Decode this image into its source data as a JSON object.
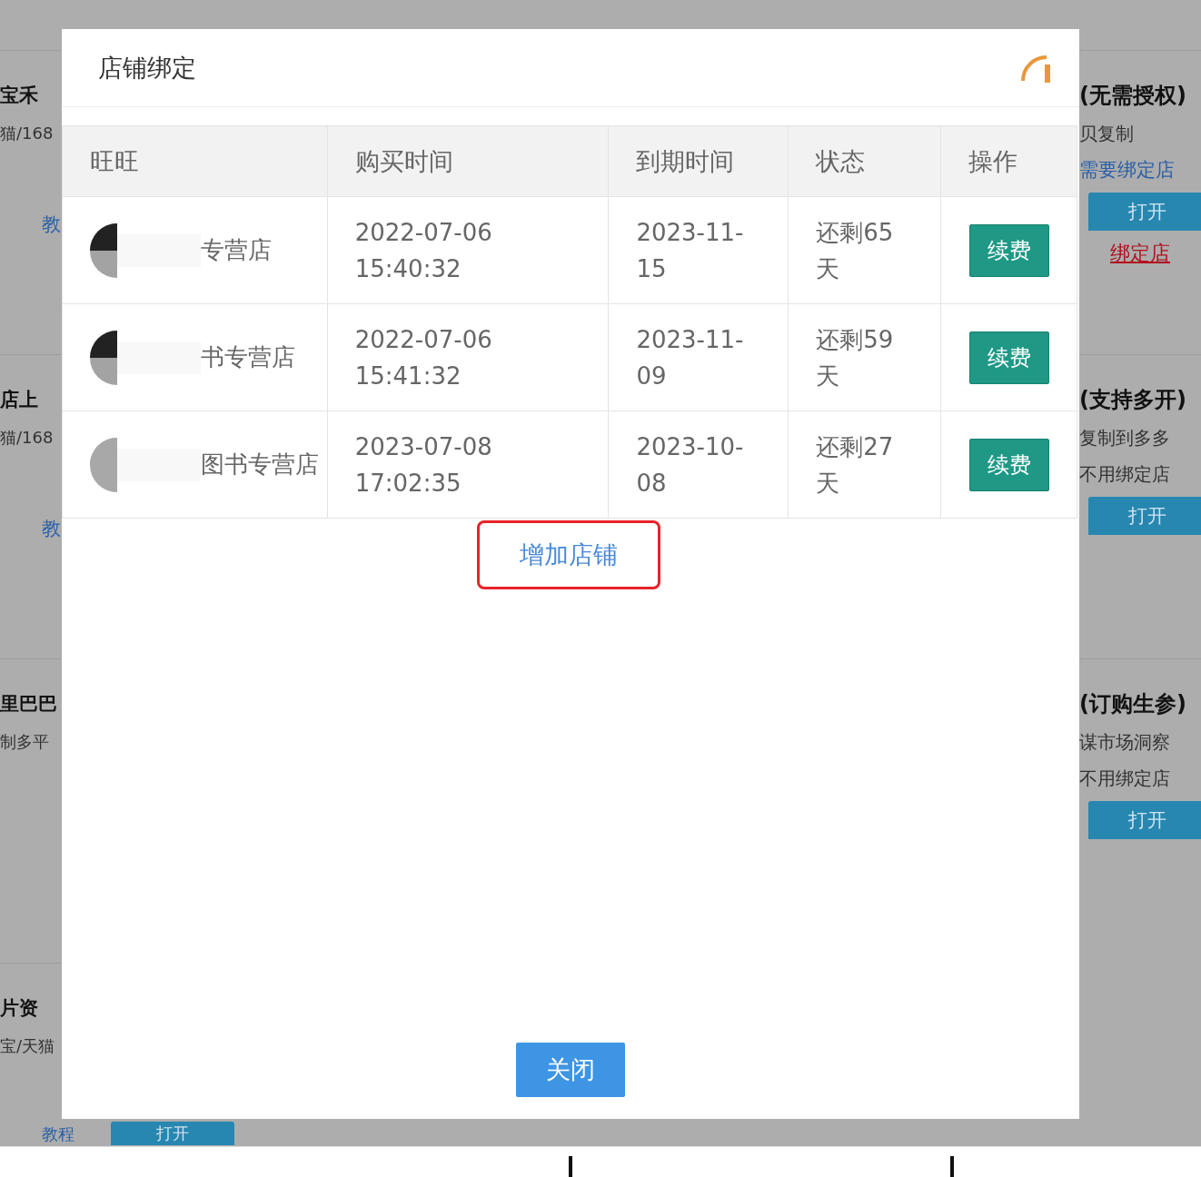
{
  "background": {
    "left_cards": [
      {
        "items": [
          {
            "kind": "title",
            "text": "宝禾"
          },
          {
            "kind": "subtitle",
            "text": "猫/168"
          },
          {
            "kind": "link",
            "text": "教"
          }
        ]
      },
      {
        "items": [
          {
            "kind": "title",
            "text": "店上"
          },
          {
            "kind": "subtitle",
            "text": "猫/168"
          },
          {
            "kind": "link",
            "text": "教"
          }
        ]
      },
      {
        "items": [
          {
            "kind": "title",
            "text": "里巴巴"
          },
          {
            "kind": "subtitle",
            "text": "制多平"
          }
        ]
      },
      {
        "items": [
          {
            "kind": "title",
            "text": "片资"
          },
          {
            "kind": "subtitle",
            "text": "宝/天猫"
          },
          {
            "kind": "link",
            "text": "教程"
          },
          {
            "kind": "button",
            "text": "打开"
          }
        ]
      }
    ],
    "right_cards": [
      {
        "items": [
          {
            "kind": "title",
            "text": "(无需授权)"
          },
          {
            "kind": "subtitle",
            "text": "贝复制"
          },
          {
            "kind": "link",
            "text": "需要绑定店"
          },
          {
            "kind": "button",
            "text": "打开"
          },
          {
            "kind": "alert",
            "text": "绑定店"
          }
        ]
      },
      {
        "items": [
          {
            "kind": "title",
            "text": "(支持多开)"
          },
          {
            "kind": "subtitle",
            "text": "复制到多多"
          },
          {
            "kind": "subtitle",
            "text": "不用绑定店"
          },
          {
            "kind": "button",
            "text": "打开"
          }
        ]
      },
      {
        "items": [
          {
            "kind": "title",
            "text": "(订购生参)"
          },
          {
            "kind": "subtitle",
            "text": "谋市场洞察"
          },
          {
            "kind": "subtitle",
            "text": "不用绑定店"
          },
          {
            "kind": "button",
            "text": "打开"
          }
        ]
      }
    ]
  },
  "dialog": {
    "title": "店铺绑定",
    "columns": [
      "旺旺",
      "购买时间",
      "到期时间",
      "状态",
      "操作"
    ],
    "rows": [
      {
        "shop": "专营店",
        "purchase_time": "2022-07-06 15:40:32",
        "expire_time": "2023-11-15",
        "status": "还剩65天",
        "action": "续费"
      },
      {
        "shop": "书专营店",
        "purchase_time": "2022-07-06 15:41:32",
        "expire_time": "2023-11-09",
        "status": "还剩59天",
        "action": "续费"
      },
      {
        "shop": "图书专营店",
        "purchase_time": "2023-07-08 17:02:35",
        "expire_time": "2023-10-08",
        "status": "还剩27天",
        "action": "续费"
      }
    ],
    "add_link": "增加店铺",
    "close_button": "关闭"
  }
}
